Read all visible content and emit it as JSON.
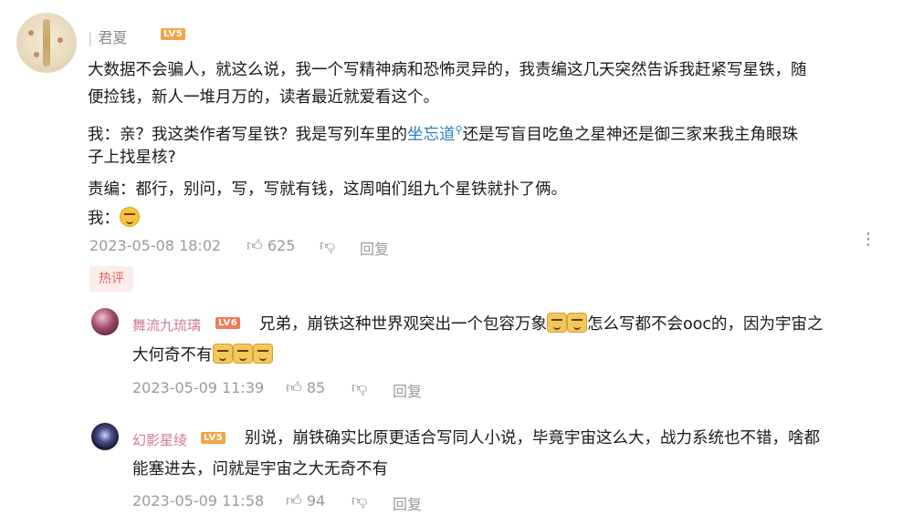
{
  "main_comment": {
    "username": "君夏",
    "level": "LV5",
    "lines": [
      "大数据不会骗人，就这么说，我一个写精神病和恐怖灵异的，我责编这几天突然告诉我赶紧写星铁，随",
      "便捡钱，新人一堆月万的，读者最近就爱看这个。"
    ],
    "line3_a": "我：亲？我这类作者写星铁？我是写列车里的",
    "line3_link": "坐忘道",
    "line3_b": "还是写盲目吃鱼之星神还是御三家来我主角眼珠",
    "line4": "子上找星核?",
    "line5": "责编：都行，别问，写，写就有钱，这周咱们组九个星铁就扑了俩。",
    "line6": "我：",
    "timestamp": "2023-05-08 18:02",
    "likes": "625",
    "reply_label": "回复"
  },
  "hot_label": "热评",
  "replies": [
    {
      "username": "舞流九琉璃",
      "level": "LV6",
      "line1_a": "兄弟，崩铁这种世界观突出一个包容万象",
      "line1_b": "怎么写都不会ooc的，因为宇宙之",
      "line2": "大何奇不有",
      "timestamp": "2023-05-09 11:39",
      "likes": "85",
      "reply_label": "回复"
    },
    {
      "username": "幻影星绫",
      "level": "LV5",
      "line1": "别说，崩铁确实比原更适合写同人小说，毕竟宇宙这么大，战力系统也不错，啥都",
      "line2": "能塞进去，问就是宇宙之大无奇不有",
      "timestamp": "2023-05-09 11:58",
      "likes": "94",
      "reply_label": "回复"
    }
  ],
  "icons": [
    "thumbs-up-icon",
    "thumbs-down-icon",
    "more-vertical-icon",
    "search-icon"
  ]
}
